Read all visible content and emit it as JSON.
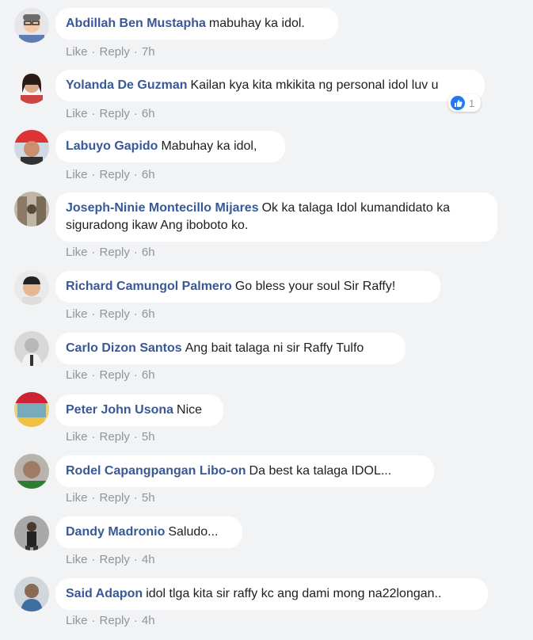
{
  "labels": {
    "like": "Like",
    "reply": "Reply",
    "sep": "·"
  },
  "colors": {
    "author": "#385898",
    "meta": "#90949c",
    "bg": "#f2f3f5",
    "like_badge": "#2078f4"
  },
  "comments": [
    {
      "author": "Abdillah Ben Mustapha",
      "text": "mabuhay ka idol.",
      "time": "7h"
    },
    {
      "author": "Yolanda De Guzman",
      "text": "Kailan kya kita mkikita ng personal idol luv u",
      "time": "6h",
      "reactions": "1"
    },
    {
      "author": "Labuyo Gapido",
      "text": "Mabuhay ka idol,",
      "time": "6h"
    },
    {
      "author": "Joseph-Ninie Montecillo Mijares",
      "text": "Ok ka talaga Idol kumandidato ka siguradong ikaw Ang iboboto ko.",
      "time": "6h"
    },
    {
      "author": "Richard Camungol Palmero",
      "text": "Go bless your soul Sir Raffy!",
      "time": "6h"
    },
    {
      "author": "Carlo Dizon Santos",
      "text": "Ang bait talaga ni sir Raffy Tulfo",
      "time": "6h"
    },
    {
      "author": "Peter John Usona",
      "text": "Nice",
      "time": "5h"
    },
    {
      "author": "Rodel Capangpangan Libo-on",
      "text": "Da best ka talaga IDOL...",
      "time": "5h"
    },
    {
      "author": "Dandy Madronio",
      "text": "Saludo...",
      "time": "4h"
    },
    {
      "author": "Said Adapon",
      "text": "idol tlga kita sir raffy kc ang dami mong na22longan..",
      "time": "4h"
    }
  ]
}
